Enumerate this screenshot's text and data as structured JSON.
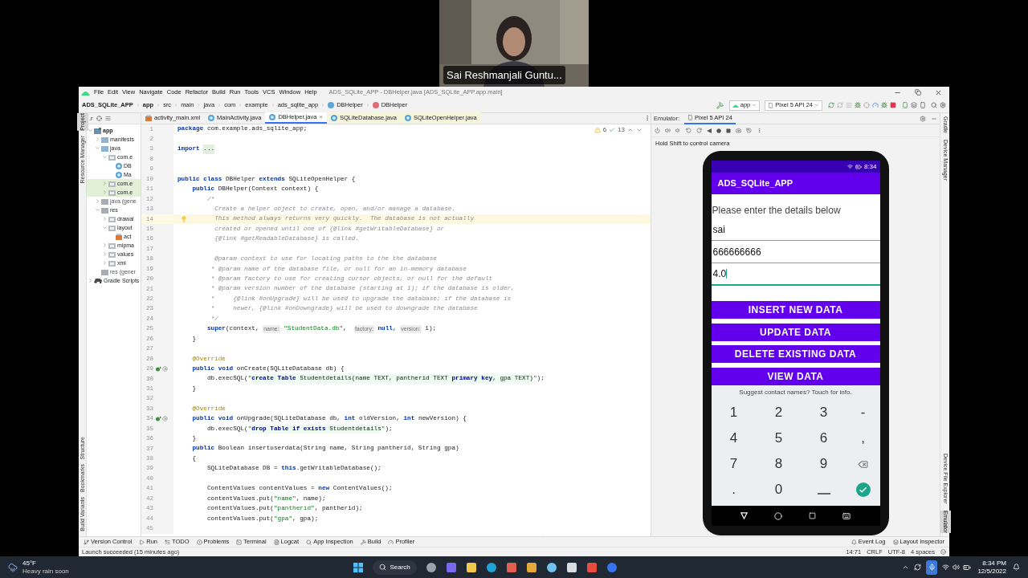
{
  "video_tile": {
    "caption": "Sai Reshmanjali Guntu..."
  },
  "window": {
    "title": "ADS_SQLite_APP - DBHelper.java [ADS_SQLite_APP.app.main]",
    "menus": [
      "File",
      "Edit",
      "View",
      "Navigate",
      "Code",
      "Refactor",
      "Build",
      "Run",
      "Tools",
      "VCS",
      "Window",
      "Help"
    ],
    "breadcrumb": [
      "ADS_SQLite_APP",
      "app",
      "src",
      "main",
      "java",
      "com",
      "example",
      "ads_sqlite_app",
      "DBHelper",
      "DBHelper"
    ],
    "toolbar": {
      "module": "app",
      "device": "Pixel 5 API 24"
    }
  },
  "left_strip": {
    "top": [
      {
        "label": "Project",
        "selected": true
      },
      {
        "label": "Resource Manager",
        "selected": false
      }
    ],
    "bottom": [
      {
        "label": "Structure",
        "selected": false
      },
      {
        "label": "Bookmarks",
        "selected": false
      },
      {
        "label": "Build Variants",
        "selected": false
      }
    ]
  },
  "right_strip": {
    "top": [
      {
        "label": "Gradle",
        "selected": false
      },
      {
        "label": "Device Manager",
        "selected": false
      }
    ],
    "bottom": [
      {
        "label": "Device File Explorer",
        "selected": false
      },
      {
        "label": "Emulator",
        "selected": true
      }
    ]
  },
  "project": {
    "view_label": ".r",
    "tree": [
      {
        "label": "app",
        "kind": "module",
        "expanded": true,
        "highlighted": false,
        "children": [
          {
            "label": "manifests",
            "kind": "folder",
            "expanded": false,
            "highlighted": false
          },
          {
            "label": "java",
            "kind": "folder",
            "expanded": true,
            "highlighted": false,
            "children": [
              {
                "label": "com.e",
                "kind": "package",
                "expanded": true,
                "highlighted": false,
                "children": [
                  {
                    "label": "DB",
                    "kind": "class",
                    "highlighted": false
                  },
                  {
                    "label": "Ma",
                    "kind": "class",
                    "highlighted": false
                  }
                ]
              },
              {
                "label": "com.e",
                "kind": "package",
                "expanded": false,
                "highlighted": true
              },
              {
                "label": "com.e",
                "kind": "package",
                "expanded": false,
                "highlighted": true
              }
            ]
          },
          {
            "label": "java (gene",
            "kind": "generated",
            "expanded": false,
            "highlighted": false
          },
          {
            "label": "res",
            "kind": "generated",
            "expanded": true,
            "highlighted": false,
            "children": [
              {
                "label": "drawal",
                "kind": "package",
                "expanded": false,
                "highlighted": false
              },
              {
                "label": "layout",
                "kind": "package",
                "expanded": true,
                "highlighted": false,
                "children": [
                  {
                    "label": "act",
                    "kind": "layout",
                    "highlighted": false
                  }
                ]
              },
              {
                "label": "mipma",
                "kind": "package",
                "expanded": false,
                "highlighted": false
              },
              {
                "label": "values",
                "kind": "package",
                "expanded": false,
                "highlighted": false
              },
              {
                "label": "xml",
                "kind": "package",
                "expanded": false,
                "highlighted": false
              }
            ]
          },
          {
            "label": "res (gener",
            "kind": "generated",
            "highlighted": false
          }
        ]
      },
      {
        "label": "Gradle Scripts",
        "kind": "gradle",
        "expanded": false,
        "highlighted": false
      }
    ]
  },
  "editor": {
    "tabs": [
      {
        "label": "activity_main.xml",
        "kind": "layout",
        "selected": false,
        "readonly": false
      },
      {
        "label": "MainActivity.java",
        "kind": "class",
        "selected": false,
        "readonly": false
      },
      {
        "label": "DBHelper.java",
        "kind": "class",
        "selected": true,
        "readonly": false
      },
      {
        "label": "SQLiteDatabase.java",
        "kind": "class",
        "selected": false,
        "readonly": true
      },
      {
        "label": "SQLiteOpenHelper.java",
        "kind": "class",
        "selected": false,
        "readonly": true
      }
    ],
    "close_mark": "×",
    "warnings": "6",
    "checks": "13",
    "lines": [
      {
        "number": "1",
        "current": false,
        "overrides": false,
        "tokens": [
          {
            "kind": "keyword",
            "text": "package"
          },
          {
            "kind": "plain",
            "text": " com.example.ads_sqlite_app;"
          }
        ]
      },
      {
        "number": "2",
        "current": false,
        "overrides": false
      },
      {
        "number": "3",
        "current": false,
        "overrides": false,
        "tokens": [
          {
            "kind": "keyword",
            "text": "import "
          },
          {
            "kind": "fold",
            "text": "..."
          }
        ]
      },
      {
        "number": "8",
        "current": false,
        "overrides": false
      },
      {
        "number": "9",
        "current": false,
        "overrides": false
      },
      {
        "number": "10",
        "current": false,
        "overrides": false,
        "tokens": [
          {
            "kind": "keyword",
            "text": "public class"
          },
          {
            "kind": "plain",
            "text": " DBHelper "
          },
          {
            "kind": "keyword",
            "text": "extends"
          },
          {
            "kind": "plain",
            "text": " SQLiteOpenHelper {"
          }
        ]
      },
      {
        "number": "11",
        "current": false,
        "overrides": false,
        "tokens": [
          {
            "kind": "keyword",
            "text": "    public"
          },
          {
            "kind": "plain",
            "text": " DBHelper(Context context) {"
          }
        ]
      },
      {
        "number": "12",
        "current": false,
        "overrides": false,
        "tokens": [
          {
            "kind": "comment",
            "text": "        /*"
          }
        ]
      },
      {
        "number": "13",
        "current": false,
        "overrides": false,
        "tokens": [
          {
            "kind": "comment",
            "text": "          Create a helper object to create, open, and/or manage a database."
          }
        ]
      },
      {
        "number": "14",
        "current": true,
        "overrides": false,
        "tokens": [
          {
            "kind": "comment",
            "text": "          This method always returns very quickly.  The database is not actually"
          }
        ]
      },
      {
        "number": "15",
        "current": false,
        "overrides": false,
        "tokens": [
          {
            "kind": "comment",
            "text": "          created or opened until one of {@link #getWritableDatabase} or"
          }
        ]
      },
      {
        "number": "16",
        "current": false,
        "overrides": false,
        "tokens": [
          {
            "kind": "comment",
            "text": "          {@link #getReadableDatabase} is called."
          }
        ]
      },
      {
        "number": "17",
        "current": false,
        "overrides": false
      },
      {
        "number": "18",
        "current": false,
        "overrides": false,
        "tokens": [
          {
            "kind": "comment",
            "text": "          @param context to use for locating paths to the the database"
          }
        ]
      },
      {
        "number": "19",
        "current": false,
        "overrides": false,
        "tokens": [
          {
            "kind": "comment",
            "text": "         * @param name of the database file, or null for an in-memory database"
          }
        ]
      },
      {
        "number": "20",
        "current": false,
        "overrides": false,
        "tokens": [
          {
            "kind": "comment",
            "text": "         * @param factory to use for creating cursor objects, or null for the default"
          }
        ]
      },
      {
        "number": "21",
        "current": false,
        "overrides": false,
        "tokens": [
          {
            "kind": "comment",
            "text": "         * @param version number of the database (starting at 1); if the database is older,"
          }
        ]
      },
      {
        "number": "22",
        "current": false,
        "overrides": false,
        "tokens": [
          {
            "kind": "comment",
            "text": "         *     {@link #onUpgrade} will be used to upgrade the database; if the database is"
          }
        ]
      },
      {
        "number": "23",
        "current": false,
        "overrides": false,
        "tokens": [
          {
            "kind": "comment",
            "text": "         *     newer, {@link #onDowngrade} will be used to downgrade the database"
          }
        ]
      },
      {
        "number": "24",
        "current": false,
        "overrides": false,
        "tokens": [
          {
            "kind": "comment",
            "text": "         */"
          }
        ]
      },
      {
        "number": "25",
        "current": false,
        "overrides": false,
        "tokens": [
          {
            "kind": "keyword",
            "text": "        super"
          },
          {
            "kind": "plain",
            "text": "(context, "
          },
          {
            "kind": "hint",
            "text": "name:"
          },
          {
            "kind": "string",
            "text": " \"StudentData.db\""
          },
          {
            "kind": "plain",
            "text": ",  "
          },
          {
            "kind": "hint",
            "text": "factory:"
          },
          {
            "kind": "keyword",
            "text": " null"
          },
          {
            "kind": "plain",
            "text": ", "
          },
          {
            "kind": "hint",
            "text": "version:"
          },
          {
            "kind": "plain",
            "text": " 1);"
          }
        ]
      },
      {
        "number": "26",
        "current": false,
        "overrides": false,
        "tokens": [
          {
            "kind": "plain",
            "text": "    }"
          }
        ]
      },
      {
        "number": "27",
        "current": false,
        "overrides": false
      },
      {
        "number": "28",
        "current": false,
        "overrides": false,
        "tokens": [
          {
            "kind": "annotation",
            "text": "    @Override"
          }
        ]
      },
      {
        "number": "29",
        "current": false,
        "overrides": true,
        "tokens": [
          {
            "kind": "keyword",
            "text": "    public void"
          },
          {
            "kind": "plain",
            "text": " onCreate(SQLiteDatabase db) {"
          }
        ]
      },
      {
        "number": "30",
        "current": false,
        "overrides": false,
        "tokens": [
          {
            "kind": "plain",
            "text": "        db.execSQL("
          },
          {
            "kind": "string",
            "text": "\""
          },
          {
            "kind": "sql_keyword",
            "text": "create Table"
          },
          {
            "kind": "sql",
            "text": " Studentdetails(name TEXT, pantherid TEXT "
          },
          {
            "kind": "sql_keyword",
            "text": "primary key"
          },
          {
            "kind": "sql",
            "text": ", gpa TEXT)"
          },
          {
            "kind": "string",
            "text": "\""
          },
          {
            "kind": "plain",
            "text": ");"
          }
        ]
      },
      {
        "number": "31",
        "current": false,
        "overrides": false,
        "tokens": [
          {
            "kind": "plain",
            "text": "    }"
          }
        ]
      },
      {
        "number": "32",
        "current": false,
        "overrides": false
      },
      {
        "number": "33",
        "current": false,
        "overrides": false,
        "tokens": [
          {
            "kind": "annotation",
            "text": "    @Override"
          }
        ]
      },
      {
        "number": "34",
        "current": false,
        "overrides": true,
        "tokens": [
          {
            "kind": "keyword",
            "text": "    public void"
          },
          {
            "kind": "plain",
            "text": " onUpgrade(SQLiteDatabase db, "
          },
          {
            "kind": "keyword",
            "text": "int"
          },
          {
            "kind": "plain",
            "text": " oldVersion, "
          },
          {
            "kind": "keyword",
            "text": "int"
          },
          {
            "kind": "plain",
            "text": " newVersion) {"
          }
        ]
      },
      {
        "number": "35",
        "current": false,
        "overrides": false,
        "tokens": [
          {
            "kind": "plain",
            "text": "        db.execSQL("
          },
          {
            "kind": "string",
            "text": "\""
          },
          {
            "kind": "sql_keyword",
            "text": "drop Table if exists"
          },
          {
            "kind": "sql",
            "text": " Studentdetails"
          },
          {
            "kind": "string",
            "text": "\""
          },
          {
            "kind": "plain",
            "text": ");"
          }
        ]
      },
      {
        "number": "36",
        "current": false,
        "overrides": false,
        "tokens": [
          {
            "kind": "plain",
            "text": "    }"
          }
        ]
      },
      {
        "number": "37",
        "current": false,
        "overrides": false,
        "tokens": [
          {
            "kind": "keyword",
            "text": "    public"
          },
          {
            "kind": "plain",
            "text": " Boolean insertuserdata(String name, String pantherid, String gpa)"
          }
        ]
      },
      {
        "number": "38",
        "current": false,
        "overrides": false,
        "tokens": [
          {
            "kind": "plain",
            "text": "    {"
          }
        ]
      },
      {
        "number": "39",
        "current": false,
        "overrides": false,
        "tokens": [
          {
            "kind": "plain",
            "text": "        SQLiteDatabase DB = "
          },
          {
            "kind": "keyword",
            "text": "this"
          },
          {
            "kind": "plain",
            "text": ".getWritableDatabase();"
          }
        ]
      },
      {
        "number": "40",
        "current": false,
        "overrides": false
      },
      {
        "number": "41",
        "current": false,
        "overrides": false,
        "tokens": [
          {
            "kind": "plain",
            "text": "        ContentValues contentValues = "
          },
          {
            "kind": "keyword",
            "text": "new"
          },
          {
            "kind": "plain",
            "text": " ContentValues();"
          }
        ]
      },
      {
        "number": "42",
        "current": false,
        "overrides": false,
        "tokens": [
          {
            "kind": "plain",
            "text": "        contentValues.put("
          },
          {
            "kind": "string",
            "text": "\"name\""
          },
          {
            "kind": "plain",
            "text": ", name);"
          }
        ]
      },
      {
        "number": "43",
        "current": false,
        "overrides": false,
        "tokens": [
          {
            "kind": "plain",
            "text": "        contentValues.put("
          },
          {
            "kind": "string",
            "text": "\"pantherid\""
          },
          {
            "kind": "plain",
            "text": ", pantherid);"
          }
        ]
      },
      {
        "number": "44",
        "current": false,
        "overrides": false,
        "tokens": [
          {
            "kind": "plain",
            "text": "        contentValues.put("
          },
          {
            "kind": "string",
            "text": "\"gpa\""
          },
          {
            "kind": "plain",
            "text": ", gpa);"
          }
        ]
      },
      {
        "number": "45",
        "current": false,
        "overrides": false
      }
    ]
  },
  "emulator": {
    "label": "Emulator:",
    "device_tab": "Pixel 5 API 24",
    "hint": "Hold Shift to control camera",
    "phone": {
      "time": "8:34",
      "app_title": "ADS_SQLite_APP",
      "prompt": "Please enter the details below",
      "fields": [
        {
          "value": "sai",
          "focused": false
        },
        {
          "value": "666666666",
          "focused": false
        },
        {
          "value": "4.0",
          "focused": true
        }
      ],
      "buttons": [
        "INSERT NEW DATA",
        "UPDATE DATA",
        "DELETE EXISTING DATA",
        "VIEW DATA"
      ],
      "suggestion": "Suggest contact names? Touch for info.",
      "keys": [
        {
          "kind": "char",
          "label": "1"
        },
        {
          "kind": "char",
          "label": "2"
        },
        {
          "kind": "char",
          "label": "3"
        },
        {
          "kind": "char",
          "label": "-"
        },
        {
          "kind": "char",
          "label": "4"
        },
        {
          "kind": "char",
          "label": "5"
        },
        {
          "kind": "char",
          "label": "6"
        },
        {
          "kind": "char",
          "label": ","
        },
        {
          "kind": "char",
          "label": "7"
        },
        {
          "kind": "char",
          "label": "8"
        },
        {
          "kind": "char",
          "label": "9"
        },
        {
          "kind": "backspace"
        },
        {
          "kind": "char",
          "label": "."
        },
        {
          "kind": "char",
          "label": "0"
        },
        {
          "kind": "space"
        },
        {
          "kind": "done"
        }
      ]
    }
  },
  "bottom_tools": {
    "left": [
      "Version Control",
      "Run",
      "TODO",
      "Problems",
      "Terminal",
      "Logcat",
      "App Inspection",
      "Build",
      "Profiler"
    ],
    "right": [
      "Event Log",
      "Layout Inspector"
    ]
  },
  "status_bar": {
    "message": "Launch succeeded (15 minutes ago)",
    "items": [
      "14:71",
      "CRLF",
      "UTF-8",
      "4 spaces"
    ]
  },
  "taskbar": {
    "temperature": "45°F",
    "forecast": "Heavy rain soon",
    "search": "Search",
    "time": "8:34 PM",
    "date": "12/5/2022"
  }
}
